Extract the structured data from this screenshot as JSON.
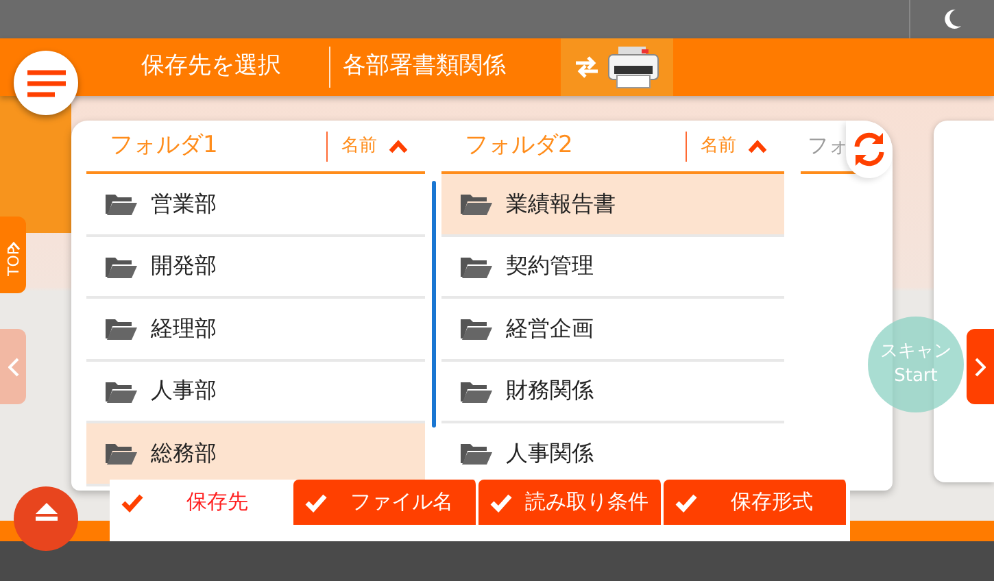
{
  "header": {
    "title": "保存先を選択",
    "path": "各部署書類関係"
  },
  "top_tab": {
    "label": "TOP"
  },
  "columns": [
    {
      "title": "フォルダ1",
      "sort_label": "名前",
      "sort_ascending": true,
      "scrollbar": true,
      "items": [
        {
          "label": "営業部",
          "selected": false
        },
        {
          "label": "開発部",
          "selected": false
        },
        {
          "label": "経理部",
          "selected": false
        },
        {
          "label": "人事部",
          "selected": false
        },
        {
          "label": "総務部",
          "selected": true
        }
      ]
    },
    {
      "title": "フォルダ2",
      "sort_label": "名前",
      "sort_ascending": true,
      "items": [
        {
          "label": "業績報告書",
          "selected": true
        },
        {
          "label": "契約管理",
          "selected": false
        },
        {
          "label": "経営企画",
          "selected": false
        },
        {
          "label": "財務関係",
          "selected": false
        },
        {
          "label": "人事関係",
          "selected": false
        }
      ]
    },
    {
      "title": "フォ"
    }
  ],
  "scan_button": {
    "lines": [
      "スキャン",
      "Start"
    ]
  },
  "tabs": [
    {
      "label": "保存先",
      "selected": true,
      "done": true
    },
    {
      "label": "ファイル名",
      "selected": false,
      "done": true
    },
    {
      "label": "読み取り条件",
      "selected": false,
      "done": true
    },
    {
      "label": "保存形式",
      "selected": false,
      "done": true
    }
  ]
}
